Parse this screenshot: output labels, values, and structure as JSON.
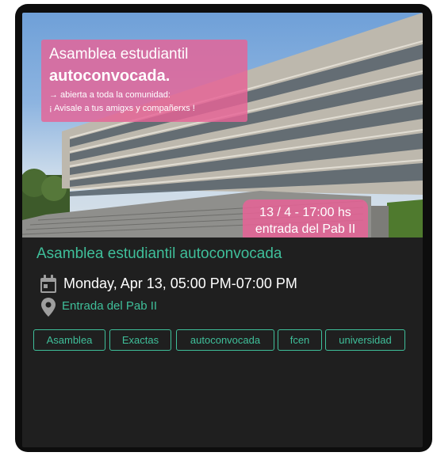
{
  "event": {
    "title": "Asamblea estudiantil autoconvocada",
    "datetime": "Monday, Apr 13, 05:00 PM-07:00 PM",
    "location": "Entrada del Pab II",
    "tags": [
      "Asamblea",
      "Exactas",
      "autoconvocada",
      "fcen",
      "universidad"
    ]
  },
  "poster": {
    "line1": "Asamblea estudiantil",
    "line2": "autoconvocada.",
    "line3": "→ abierta a toda la comunidad:",
    "line4": "¡ Avisale a tus amigxs y compañerxs !",
    "date_time": "13 / 4 - 17:00 hs",
    "place": "entrada del Pab II"
  },
  "colors": {
    "accent": "#3fbf9a",
    "card_bg": "#1f1f1f",
    "poster_pink": "#e76396"
  },
  "icons": {
    "date": "calendar-icon",
    "location": "map-pin-icon"
  }
}
